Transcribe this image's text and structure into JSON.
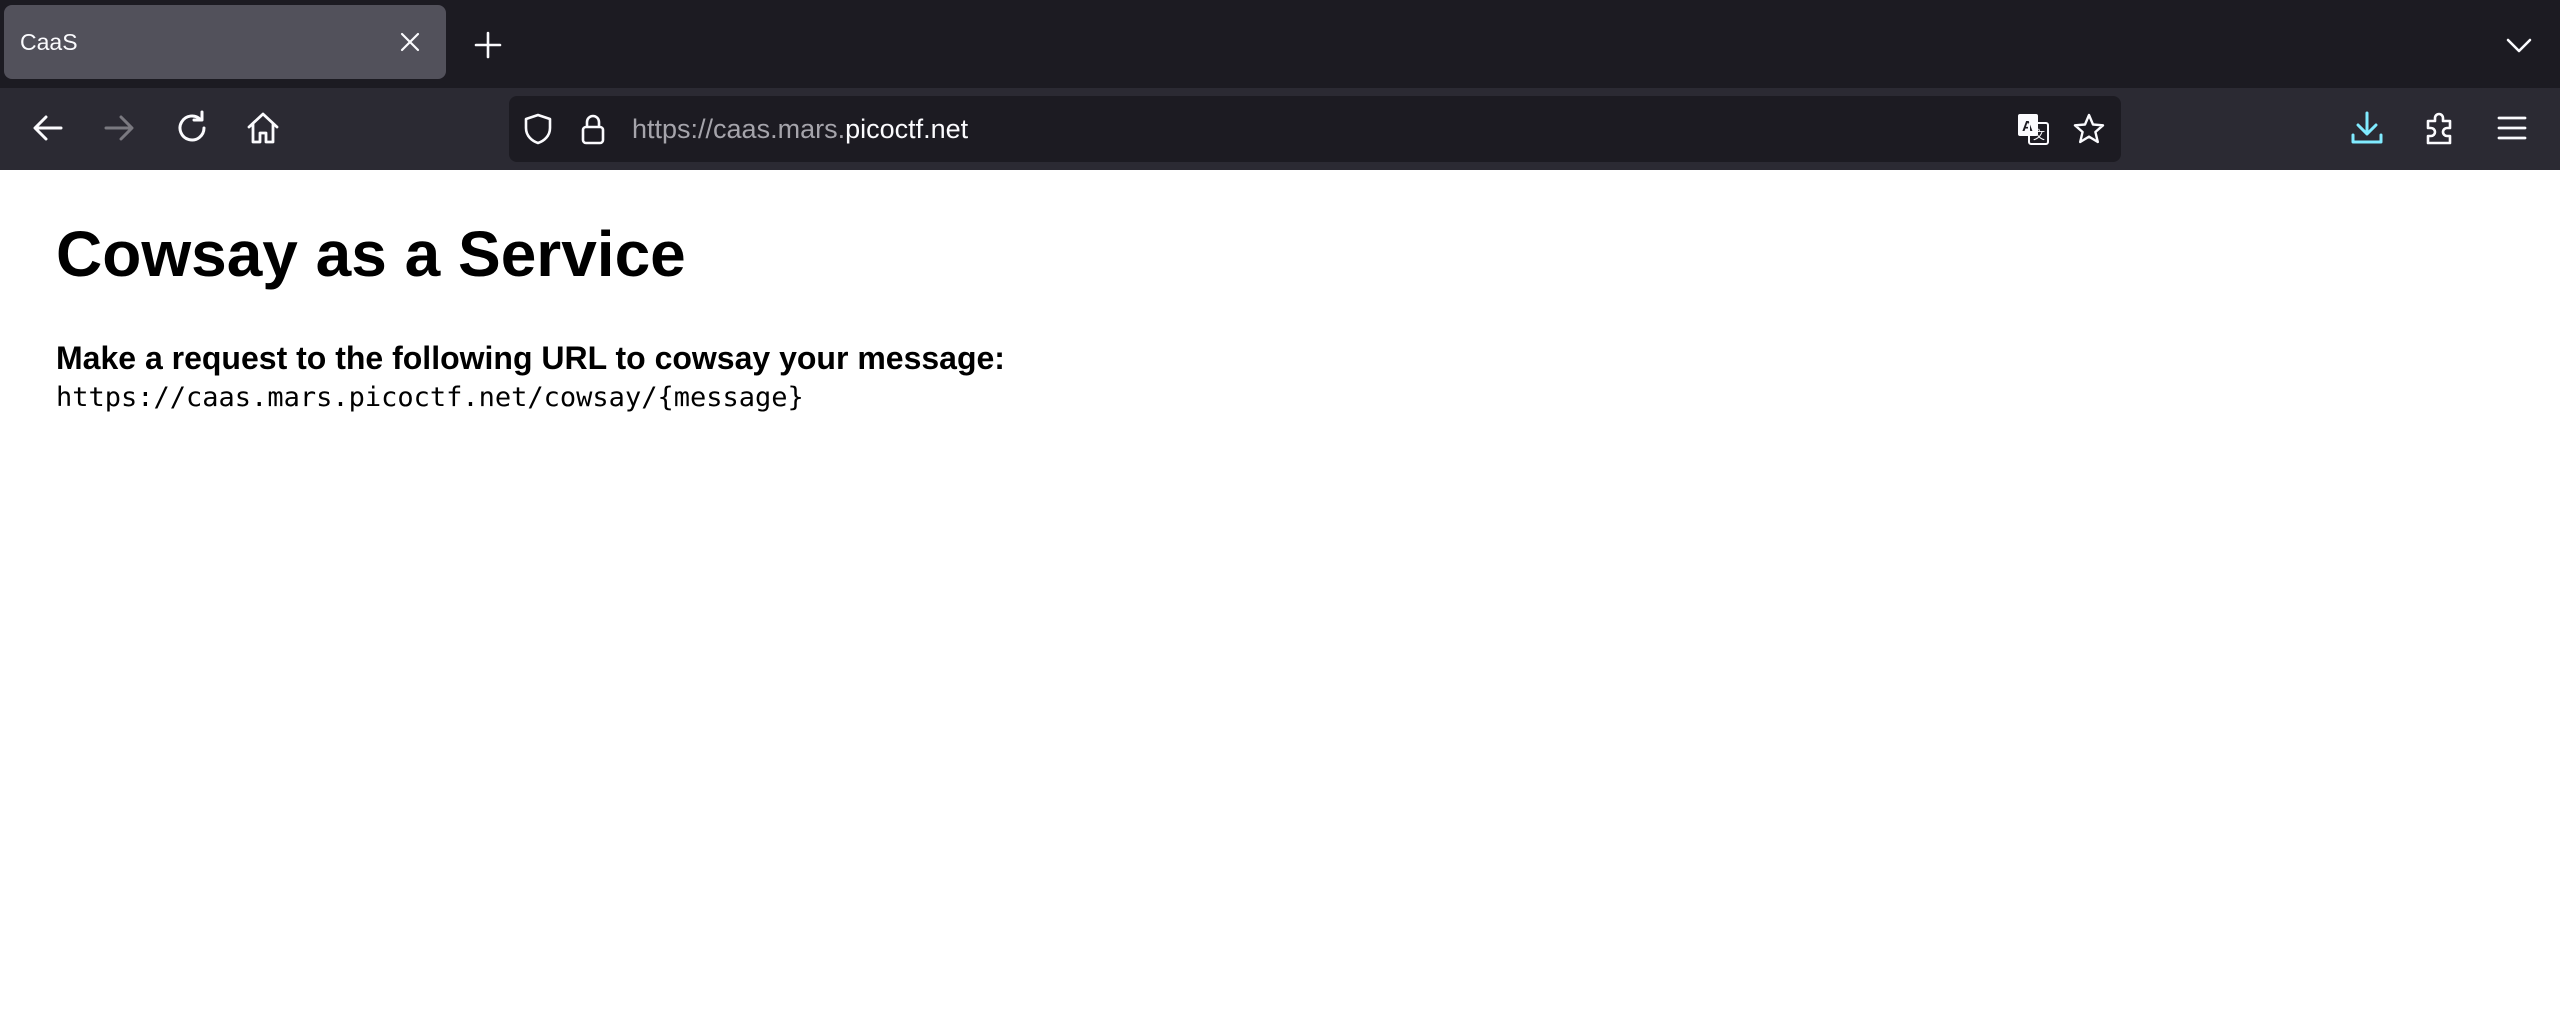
{
  "tab": {
    "title": "CaaS"
  },
  "urlbar": {
    "url_prefix": "https://caas.mars.",
    "url_domain": "picoctf.net"
  },
  "icons": {
    "tab_close": "close-icon",
    "new_tab": "plus-icon",
    "tab_list": "chevron-down-icon",
    "back": "back-arrow-icon",
    "forward": "forward-arrow-icon",
    "reload": "reload-icon",
    "home": "home-icon",
    "tracking": "shield-icon",
    "security": "lock-icon",
    "translate": "translate-icon",
    "bookmark": "star-icon",
    "downloads": "download-icon",
    "extensions": "puzzle-icon",
    "menu": "hamburger-menu-icon"
  },
  "colors": {
    "download_accent": "#54ffbd",
    "download_blue": "#80ebff"
  },
  "page": {
    "heading": "Cowsay as a Service",
    "subheading": "Make a request to the following URL to cowsay your message:",
    "endpoint": "https://caas.mars.picoctf.net/cowsay/{message}"
  }
}
